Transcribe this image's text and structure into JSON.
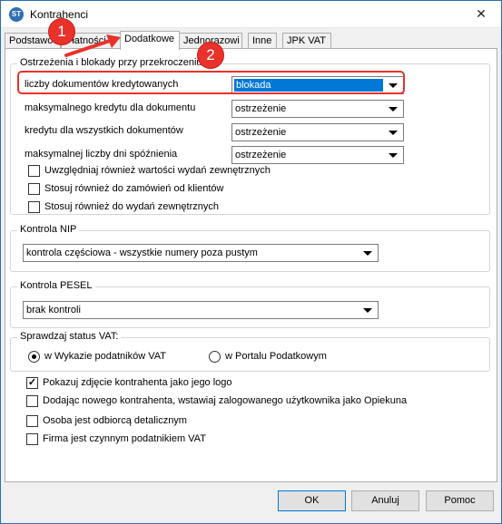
{
  "window": {
    "title": "Kontrahenci",
    "icon": "app-logo-icon",
    "close_glyph": "✕"
  },
  "tabs": [
    {
      "label": "Podstawowe"
    },
    {
      "label": "Płatności"
    },
    {
      "label": "Dodatkowe"
    },
    {
      "label": "Jednorazowi"
    },
    {
      "label": "Inne"
    },
    {
      "label": "JPK VAT"
    }
  ],
  "warnings": {
    "legend": "Ostrzeżenia i blokady przy przekroczeniu:",
    "rows": [
      {
        "label": "liczby dokumentów kredytowanych",
        "value": "blokada"
      },
      {
        "label": "maksymalnego kredytu dla  dokumentu",
        "value": "ostrzeżenie"
      },
      {
        "label": "kredytu dla wszystkich dokumentów",
        "value": "ostrzeżenie"
      },
      {
        "label": "maksymalnej liczby dni spóźnienia",
        "value": "ostrzeżenie"
      }
    ],
    "checks": [
      {
        "label": "Uwzględniaj również wartości wydań zewnętrznych",
        "checked": false
      },
      {
        "label": "Stosuj również do zamówień od klientów",
        "checked": false
      },
      {
        "label": "Stosuj również do wydań zewnętrznych",
        "checked": false
      }
    ]
  },
  "nip": {
    "legend": "Kontrola NIP",
    "value": "kontrola częściowa - wszystkie numery poza pustym"
  },
  "pesel": {
    "legend": "Kontrola PESEL",
    "value": "brak kontroli"
  },
  "vat_status": {
    "legend": "Sprawdzaj status VAT:",
    "options": [
      {
        "label": "w Wykazie podatników VAT",
        "selected": true
      },
      {
        "label": "w Portalu Podatkowym",
        "selected": false
      }
    ]
  },
  "options": [
    {
      "label": "Pokazuj zdjęcie kontrahenta jako jego logo",
      "checked": true
    },
    {
      "label": "Dodając nowego kontrahenta, wstawiaj zalogowanego użytkownika jako Opiekuna",
      "checked": false
    },
    {
      "label": "Osoba jest odbiorcą detalicznym",
      "checked": false
    },
    {
      "label": "Firma jest czynnym podatnikiem VAT",
      "checked": false
    }
  ],
  "buttons": {
    "ok": "OK",
    "cancel": "Anuluj",
    "help": "Pomoc"
  },
  "annotations": {
    "badge1": "1",
    "badge2": "2",
    "color": "#e8322b"
  },
  "check_glyph": "✓"
}
